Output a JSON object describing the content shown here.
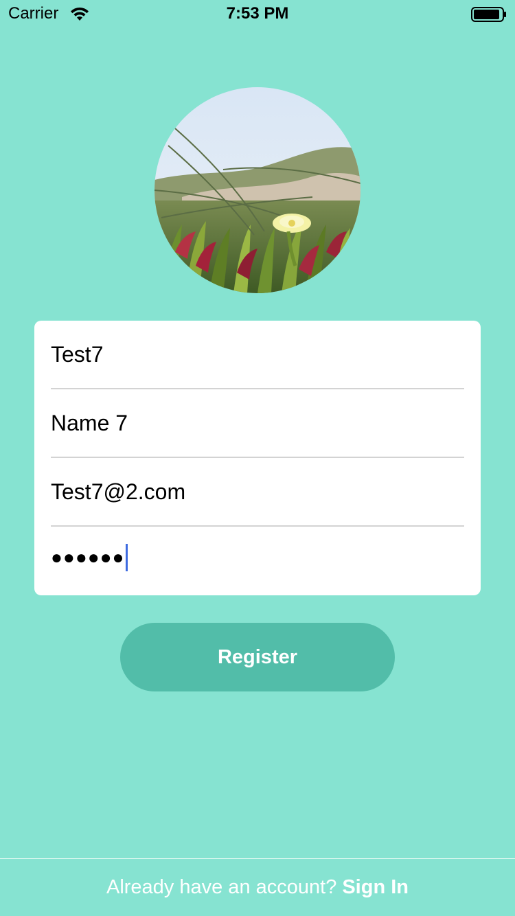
{
  "status_bar": {
    "carrier": "Carrier",
    "time": "7:53 PM",
    "icons": [
      "wifi-icon",
      "battery-icon"
    ]
  },
  "avatar": {
    "image": "profile-photo"
  },
  "form": {
    "username_value": "Test7",
    "name_value": "Name 7",
    "email_value": "Test7@2.com",
    "password_mask": "●●●●●●"
  },
  "register_button": {
    "label": "Register"
  },
  "footer": {
    "prompt": "Already have an account?",
    "link": "Sign In"
  },
  "colors": {
    "background": "#86E3D1",
    "button": "#52BDA9",
    "card": "#FFFFFF",
    "caret": "#3E6BE0"
  }
}
